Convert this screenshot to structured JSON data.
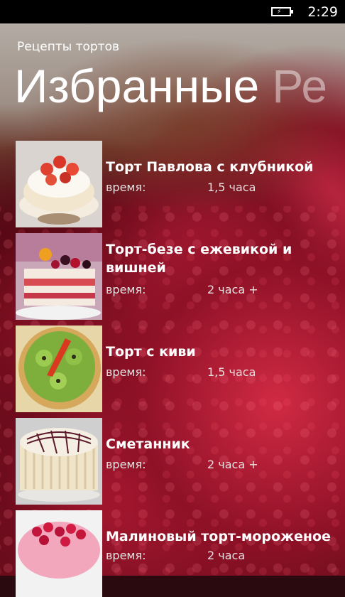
{
  "status": {
    "time": "2:29",
    "battery_icon": "battery-charging-icon"
  },
  "app": {
    "title": "Рецепты тортов"
  },
  "pivot": {
    "current": "Избранные",
    "next": "Ре"
  },
  "time_label": "время:",
  "recipes": [
    {
      "title": "Торт Павлова с клубникой",
      "time": "1,5 часа"
    },
    {
      "title": "Торт-безе с ежевикой и вишней",
      "time": "2 часа +"
    },
    {
      "title": "Торт с киви",
      "time": "1,5 часа"
    },
    {
      "title": "Сметанник",
      "time": "2 часа +"
    },
    {
      "title": "Малиновый торт-мороженое",
      "time": "2 часа"
    }
  ]
}
